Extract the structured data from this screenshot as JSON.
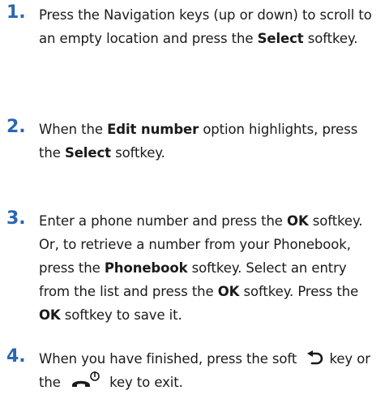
{
  "colors": {
    "step_number": "#2a67b0",
    "text": "#1a1a1a"
  },
  "steps": [
    {
      "number": "1.",
      "parts": [
        "Press the Navigation keys (up or down) to scroll to an empty location and press the ",
        "Select",
        " softkey."
      ]
    },
    {
      "number": "2.",
      "parts": [
        "When the ",
        "Edit number",
        " option highlights, press the ",
        "Select",
        " softkey."
      ]
    },
    {
      "number": "3.",
      "parts": [
        "Enter a phone number and press the ",
        "OK",
        " softkey. Or, to retrieve a number from your Phonebook, press the ",
        "Phonebook",
        " softkey. Select an entry from the list and press the ",
        "OK",
        " softkey. Press the ",
        "OK",
        " softkey to save it."
      ]
    },
    {
      "number": "4.",
      "parts": [
        "When you have finished, press the soft ",
        " key or the ",
        " key to exit."
      ],
      "icons": [
        "back-icon",
        "end-call-power-icon"
      ]
    }
  ]
}
